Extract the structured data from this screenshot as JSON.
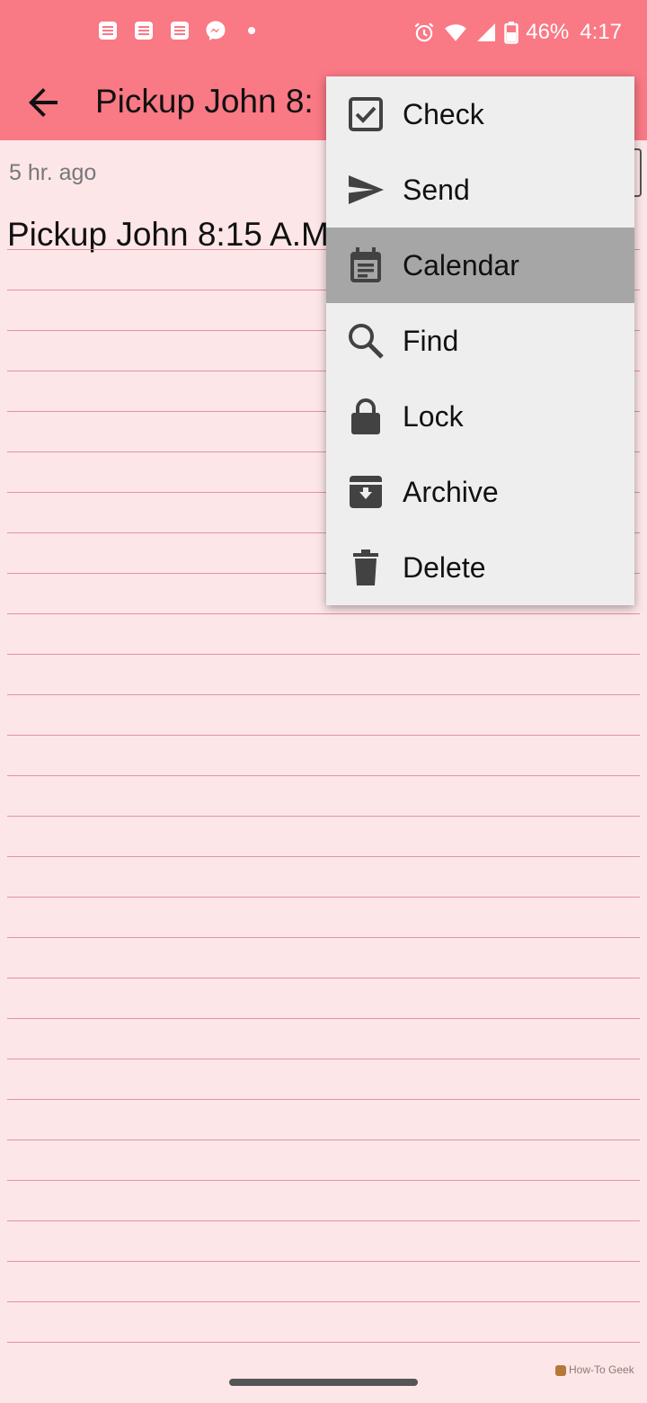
{
  "status_bar": {
    "notification_icons": [
      "note-icon",
      "note-icon",
      "note-icon",
      "messenger-icon",
      "dot-icon"
    ],
    "system_icons": [
      "alarm-icon",
      "wifi-icon",
      "cell-signal-icon",
      "battery-icon"
    ],
    "battery": "46%",
    "time": "4:17"
  },
  "app_bar": {
    "back_icon": "back-arrow-icon",
    "title": "Pickup John 8:"
  },
  "note": {
    "timestamp": "5 hr. ago",
    "text": "Pickup John 8:15 A.M"
  },
  "menu": {
    "items": [
      {
        "label": "Check",
        "icon": "checkbox-icon"
      },
      {
        "label": "Send",
        "icon": "send-icon"
      },
      {
        "label": "Calendar",
        "icon": "calendar-icon",
        "highlighted": true
      },
      {
        "label": "Find",
        "icon": "search-icon"
      },
      {
        "label": "Lock",
        "icon": "lock-icon"
      },
      {
        "label": "Archive",
        "icon": "archive-icon"
      },
      {
        "label": "Delete",
        "icon": "trash-icon"
      }
    ]
  },
  "watermark": "How-To Geek",
  "colors": {
    "accent": "#f97985",
    "paper": "#fde6e8",
    "rule_line": "#e0949c",
    "menu_bg": "#eeeeee",
    "menu_highlight": "#a6a6a6",
    "icon": "#424242"
  }
}
